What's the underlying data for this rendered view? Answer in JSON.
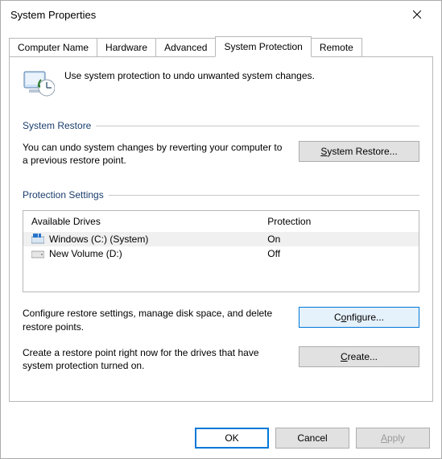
{
  "window": {
    "title": "System Properties"
  },
  "tabs": {
    "items": [
      {
        "label": "Computer Name"
      },
      {
        "label": "Hardware"
      },
      {
        "label": "Advanced"
      },
      {
        "label": "System Protection"
      },
      {
        "label": "Remote"
      }
    ],
    "active_index": 3
  },
  "intro": {
    "text": "Use system protection to undo unwanted system changes."
  },
  "groups": {
    "restore_label": "System Restore",
    "protection_label": "Protection Settings"
  },
  "restore": {
    "description": "You can undo system changes by reverting your computer to a previous restore point.",
    "button": "System Restore..."
  },
  "drives": {
    "headers": {
      "drive": "Available Drives",
      "protection": "Protection"
    },
    "rows": [
      {
        "name": "Windows (C:) (System)",
        "protection": "On",
        "selected": true,
        "icon": "drive-windows"
      },
      {
        "name": "New Volume (D:)",
        "protection": "Off",
        "selected": false,
        "icon": "drive-generic"
      }
    ]
  },
  "configure": {
    "description": "Configure restore settings, manage disk space, and delete restore points.",
    "button": "Configure..."
  },
  "create": {
    "description": "Create a restore point right now for the drives that have system protection turned on.",
    "button": "Create..."
  },
  "dialog_buttons": {
    "ok": "OK",
    "cancel": "Cancel",
    "apply": "Apply"
  }
}
